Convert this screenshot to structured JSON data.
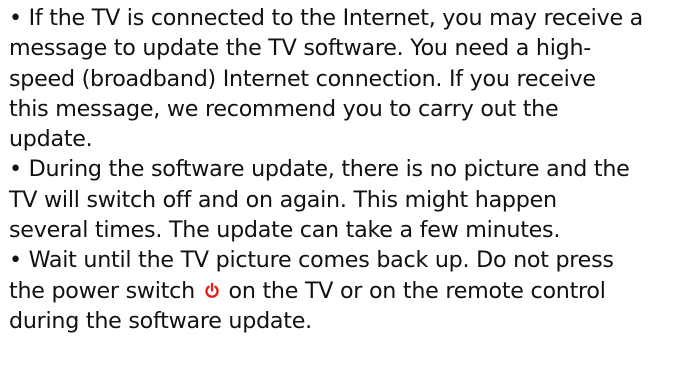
{
  "paragraphs": [
    "• If the TV is connected to the Internet, you may receive a\nmessage to update the TV software. You need a high-\nspeed (broadband) Internet connection. If you receive\nthis message, we recommend you to carry out the\nupdate.",
    "• During the software update, there is no picture and the\nTV will switch off and on again. This might happen\nseveral times. The update can take a few minutes."
  ],
  "last_paragraph": {
    "before_icon": "• Wait until the TV picture comes back up. Do not press\nthe power switch ",
    "icon": "power-icon",
    "after_icon": " on the TV or on the remote control\nduring the software update."
  },
  "colors": {
    "text": "#111111",
    "power_icon": "#e8201a"
  }
}
